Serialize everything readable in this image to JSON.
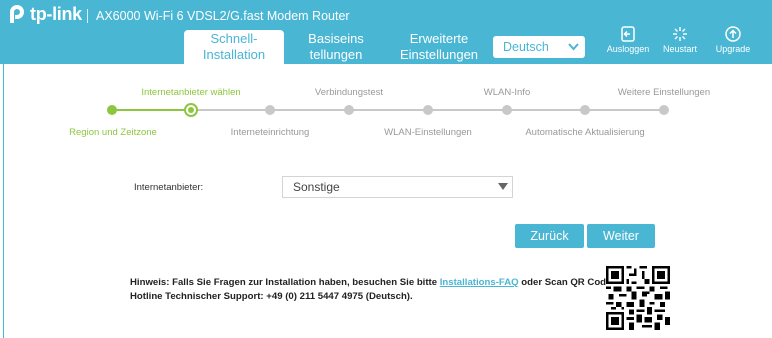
{
  "header": {
    "brand": "tp-link",
    "model": "AX6000 Wi-Fi 6 VDSL2/G.fast Modem Router",
    "tabs": [
      {
        "label_line1": "Schnell-",
        "label_line2": "Installation"
      },
      {
        "label_line1": "Basiseins",
        "label_line2": "tellungen"
      },
      {
        "label_line1": "Erweiterte",
        "label_line2": "Einstellungen"
      }
    ],
    "language": "Deutsch",
    "buttons": {
      "logout": "Ausloggen",
      "reboot": "Neustart",
      "upgrade": "Upgrade"
    },
    "accent": "#49b6d4"
  },
  "stepper": {
    "top_labels": [
      "Internetanbieter wählen",
      "Verbindungstest",
      "WLAN-Info",
      "Weitere Einstellungen"
    ],
    "bottom_labels": [
      "Region und Zeitzone",
      "Interneteinrichtung",
      "WLAN-Einstellungen",
      "Automatische Aktualisierung"
    ],
    "current_step": 2,
    "total_steps": 8,
    "done_color": "#8dc63f"
  },
  "form": {
    "provider_label": "Internetanbieter:",
    "provider_value": "Sonstige"
  },
  "actions": {
    "back": "Zurück",
    "next": "Weiter"
  },
  "hint": {
    "line1_prefix": "Hinweis: Falls Sie Fragen zur Installation haben, besuchen Sie bitte ",
    "link": "Installations-FAQ",
    "line1_suffix": " oder Scan QR Code.",
    "line2": "Hotline Technischer Support: +49 (0) 211 5447 4975 (Deutsch)."
  }
}
